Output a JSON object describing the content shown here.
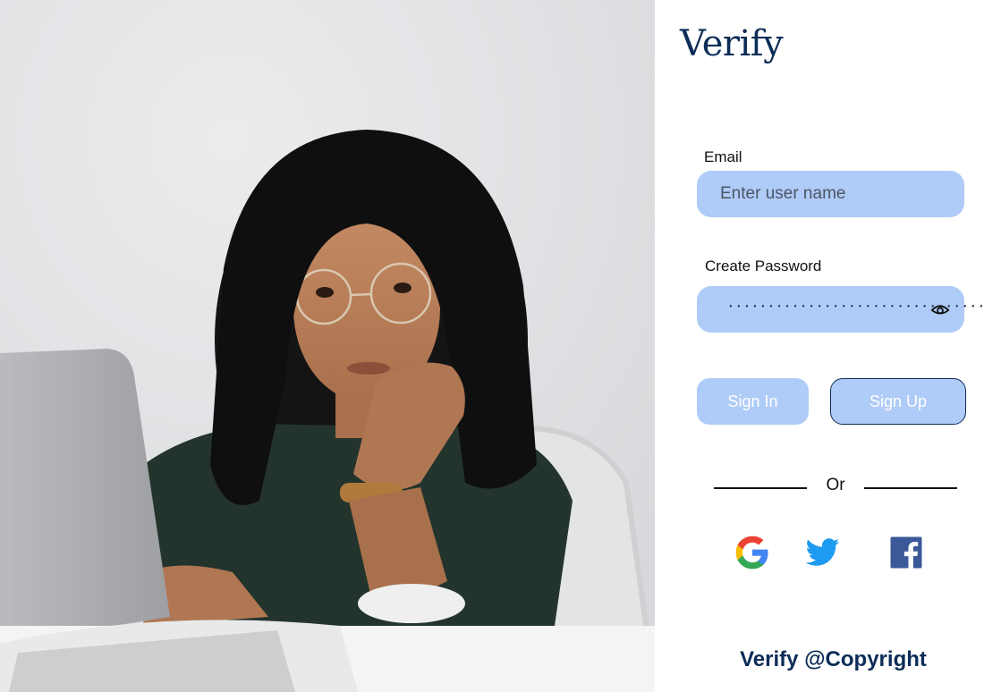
{
  "brand": {
    "title": "Verify"
  },
  "form": {
    "email_label": "Email",
    "email_placeholder": "Enter user name",
    "email_value": "",
    "password_label": "Create Password",
    "password_value": "································"
  },
  "actions": {
    "sign_in_label": "Sign In",
    "sign_up_label": "Sign Up"
  },
  "divider": {
    "text": "Or"
  },
  "social": [
    {
      "name": "google-icon"
    },
    {
      "name": "twitter-icon"
    },
    {
      "name": "facebook-icon"
    }
  ],
  "footer": {
    "text": "Verify @Copyright"
  },
  "colors": {
    "brand_navy": "#0c2d57",
    "input_fill": "#afcbf7",
    "twitter": "#1d9bf0",
    "facebook": "#3b5998"
  }
}
